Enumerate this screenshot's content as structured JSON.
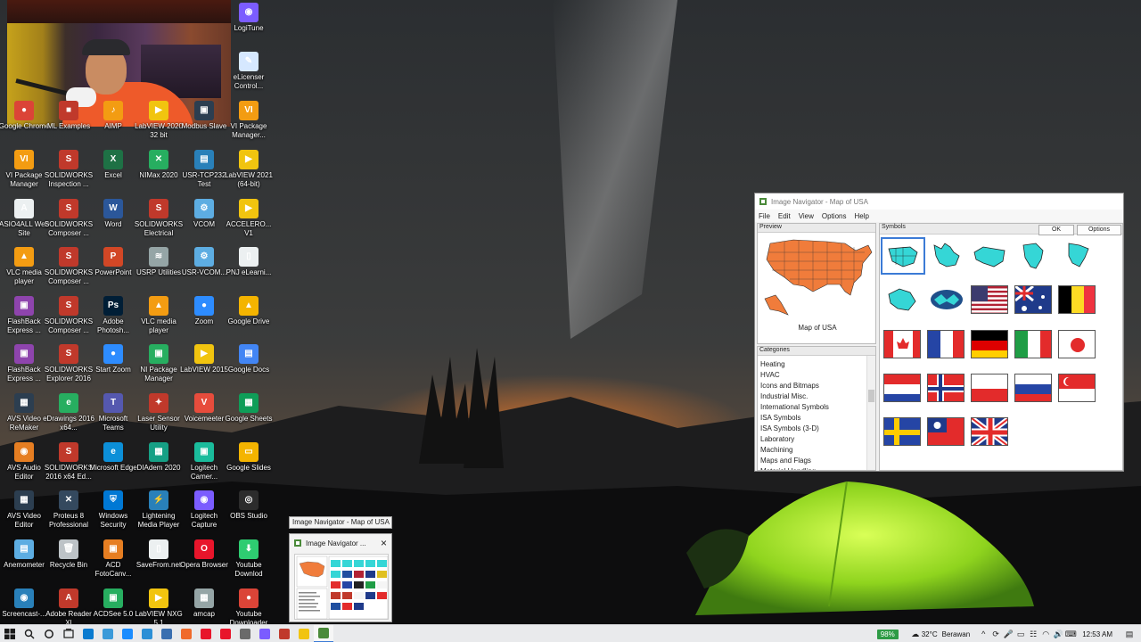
{
  "desktop": {
    "icons": [
      {
        "label": "LogiTune",
        "color": "#7b5cff",
        "glyph": "◉"
      },
      {
        "label": "eLicenser Control...",
        "color": "#d6e8ff",
        "glyph": "✎"
      },
      {
        "label": "Google Chrome",
        "color": "#db4437",
        "glyph": "●"
      },
      {
        "label": "ML Examples",
        "color": "#c0392b",
        "glyph": "■"
      },
      {
        "label": "AIMP",
        "color": "#f39c12",
        "glyph": "♪"
      },
      {
        "label": "LabVIEW 2020 32 bit",
        "color": "#f1c40f",
        "glyph": "▶"
      },
      {
        "label": "Modbus Slave",
        "color": "#2c3e50",
        "glyph": "▣"
      },
      {
        "label": "VI Package Manager...",
        "color": "#f39c12",
        "glyph": "VI"
      },
      {
        "label": "VI Package Manager",
        "color": "#f39c12",
        "glyph": "VI"
      },
      {
        "label": "SOLIDWORKS Inspection ...",
        "color": "#c0392b",
        "glyph": "S"
      },
      {
        "label": "Excel",
        "color": "#1e7145",
        "glyph": "X"
      },
      {
        "label": "NIMax 2020",
        "color": "#27ae60",
        "glyph": "✕"
      },
      {
        "label": "USR-TCP232 Test",
        "color": "#2980b9",
        "glyph": "▤"
      },
      {
        "label": "LabVIEW 2021 (64-bit)",
        "color": "#f1c40f",
        "glyph": "▶"
      },
      {
        "label": "ASIO4ALL Web Site",
        "color": "#ecf0f1",
        "glyph": "A"
      },
      {
        "label": "SOLIDWORKS Composer ...",
        "color": "#c0392b",
        "glyph": "S"
      },
      {
        "label": "Word",
        "color": "#2b579a",
        "glyph": "W"
      },
      {
        "label": "SOLIDWORKS Electrical",
        "color": "#c0392b",
        "glyph": "S"
      },
      {
        "label": "VCOM",
        "color": "#5dade2",
        "glyph": "⚙"
      },
      {
        "label": "ACCELERO... V1",
        "color": "#f1c40f",
        "glyph": "▶"
      },
      {
        "label": "VLC media player",
        "color": "#f39c12",
        "glyph": "▲"
      },
      {
        "label": "SOLIDWORKS Composer ...",
        "color": "#c0392b",
        "glyph": "S"
      },
      {
        "label": "PowerPoint",
        "color": "#d24726",
        "glyph": "P"
      },
      {
        "label": "USRP Utilities",
        "color": "#95a5a6",
        "glyph": "≋"
      },
      {
        "label": "USR-VCOM...",
        "color": "#5dade2",
        "glyph": "⚙"
      },
      {
        "label": "PNJ eLearni...",
        "color": "#ecf0f1",
        "glyph": "▯"
      },
      {
        "label": "FlashBack Express ...",
        "color": "#8e44ad",
        "glyph": "▣"
      },
      {
        "label": "SOLIDWORKS Composer ...",
        "color": "#c0392b",
        "glyph": "S"
      },
      {
        "label": "Adobe Photosh...",
        "color": "#001e36",
        "glyph": "Ps"
      },
      {
        "label": "VLC media player",
        "color": "#f39c12",
        "glyph": "▲"
      },
      {
        "label": "Zoom",
        "color": "#2d8cff",
        "glyph": "●"
      },
      {
        "label": "Google Drive",
        "color": "#f4b400",
        "glyph": "▲"
      },
      {
        "label": "FlashBack Express ...",
        "color": "#8e44ad",
        "glyph": "▣"
      },
      {
        "label": "SOLIDWORKS Explorer 2016",
        "color": "#c0392b",
        "glyph": "S"
      },
      {
        "label": "Start Zoom",
        "color": "#2d8cff",
        "glyph": "●"
      },
      {
        "label": "NI Package Manager",
        "color": "#27ae60",
        "glyph": "▣"
      },
      {
        "label": "LabVIEW 2015",
        "color": "#f1c40f",
        "glyph": "▶"
      },
      {
        "label": "Google Docs",
        "color": "#4285f4",
        "glyph": "▤"
      },
      {
        "label": "AVS Video ReMaker",
        "color": "#2c3e50",
        "glyph": "▦"
      },
      {
        "label": "eDrawings 2016 x64...",
        "color": "#27ae60",
        "glyph": "e"
      },
      {
        "label": "Microsoft Teams",
        "color": "#5558af",
        "glyph": "T"
      },
      {
        "label": "Laser Sensor Utility",
        "color": "#c0392b",
        "glyph": "✦"
      },
      {
        "label": "Voicemeeter",
        "color": "#e74c3c",
        "glyph": "V"
      },
      {
        "label": "Google Sheets",
        "color": "#0f9d58",
        "glyph": "▦"
      },
      {
        "label": "AVS Audio Editor",
        "color": "#e67e22",
        "glyph": "◉"
      },
      {
        "label": "SOLIDWORKS 2016 x64 Ed...",
        "color": "#c0392b",
        "glyph": "S"
      },
      {
        "label": "Microsoft Edge",
        "color": "#0c8fd8",
        "glyph": "e"
      },
      {
        "label": "DIAdem 2020",
        "color": "#16a085",
        "glyph": "▦"
      },
      {
        "label": "Logitech Camer...",
        "color": "#1abc9c",
        "glyph": "▣"
      },
      {
        "label": "Google Slides",
        "color": "#f4b400",
        "glyph": "▭"
      },
      {
        "label": "AVS Video Editor",
        "color": "#2c3e50",
        "glyph": "▦"
      },
      {
        "label": "Proteus 8 Professional",
        "color": "#34495e",
        "glyph": "✕"
      },
      {
        "label": "Windows Security",
        "color": "#0078d4",
        "glyph": "⛨"
      },
      {
        "label": "Lightening Media Player",
        "color": "#2980b9",
        "glyph": "⚡"
      },
      {
        "label": "Logitech Capture",
        "color": "#7b5cff",
        "glyph": "◉"
      },
      {
        "label": "OBS Studio",
        "color": "#2c2c2c",
        "glyph": "◎"
      },
      {
        "label": "Anemometer",
        "color": "#5dade2",
        "glyph": "▤"
      },
      {
        "label": "Recycle Bin",
        "color": "#bdc3c7",
        "glyph": "🗑"
      },
      {
        "label": "ACD FotoCanv...",
        "color": "#e67e22",
        "glyph": "▣"
      },
      {
        "label": "SaveFrom.net",
        "color": "#ecf0f1",
        "glyph": "▯"
      },
      {
        "label": "Opera Browser",
        "color": "#e8152b",
        "glyph": "O"
      },
      {
        "label": "Youtube Downlod",
        "color": "#2ecc71",
        "glyph": "⬇"
      },
      {
        "label": "Screencast-...",
        "color": "#2980b9",
        "glyph": "◉"
      },
      {
        "label": "Adobe Reader XI",
        "color": "#c0392b",
        "glyph": "A"
      },
      {
        "label": "ACDSee 5.0",
        "color": "#27ae60",
        "glyph": "▣"
      },
      {
        "label": "LabVIEW NXG 5.1",
        "color": "#f1c40f",
        "glyph": "▶"
      },
      {
        "label": "amcap",
        "color": "#95a5a6",
        "glyph": "▦"
      },
      {
        "label": "Youtube Downloader",
        "color": "#db4437",
        "glyph": "●"
      }
    ]
  },
  "image_navigator": {
    "title": "Image Navigator - Map of USA",
    "menu": [
      "File",
      "Edit",
      "View",
      "Options",
      "Help"
    ],
    "preview_caption": "Preview",
    "preview_label": "Map of USA",
    "categories_caption": "Categories",
    "categories": [
      "Heating",
      "HVAC",
      "Icons and Bitmaps",
      "Industrial Misc.",
      "International Symbols",
      "ISA Symbols",
      "ISA Symbols (3-D)",
      "Laboratory",
      "Machining",
      "Maps and Flags",
      "Material Handling"
    ],
    "symbols_caption": "Symbols",
    "ok_label": "OK",
    "options_label": "Options",
    "map_color": "#f07c3b",
    "continent_color": "#35d6d6",
    "flags": [
      "usa",
      "australia",
      "belgium",
      "canada",
      "france",
      "germany",
      "italy",
      "japan",
      "netherlands",
      "norway",
      "poland",
      "russia",
      "singapore",
      "sweden",
      "taiwan",
      "uk"
    ]
  },
  "taskbar_preview": {
    "tooltip": "Image Navigator - Map of USA",
    "card_title": "Image Navigator ..."
  },
  "taskbar": {
    "battery": "98%",
    "temperature": "32°C",
    "weather": "Berawan",
    "clock": "12:53 AM",
    "accent": "#3b7bd6"
  }
}
